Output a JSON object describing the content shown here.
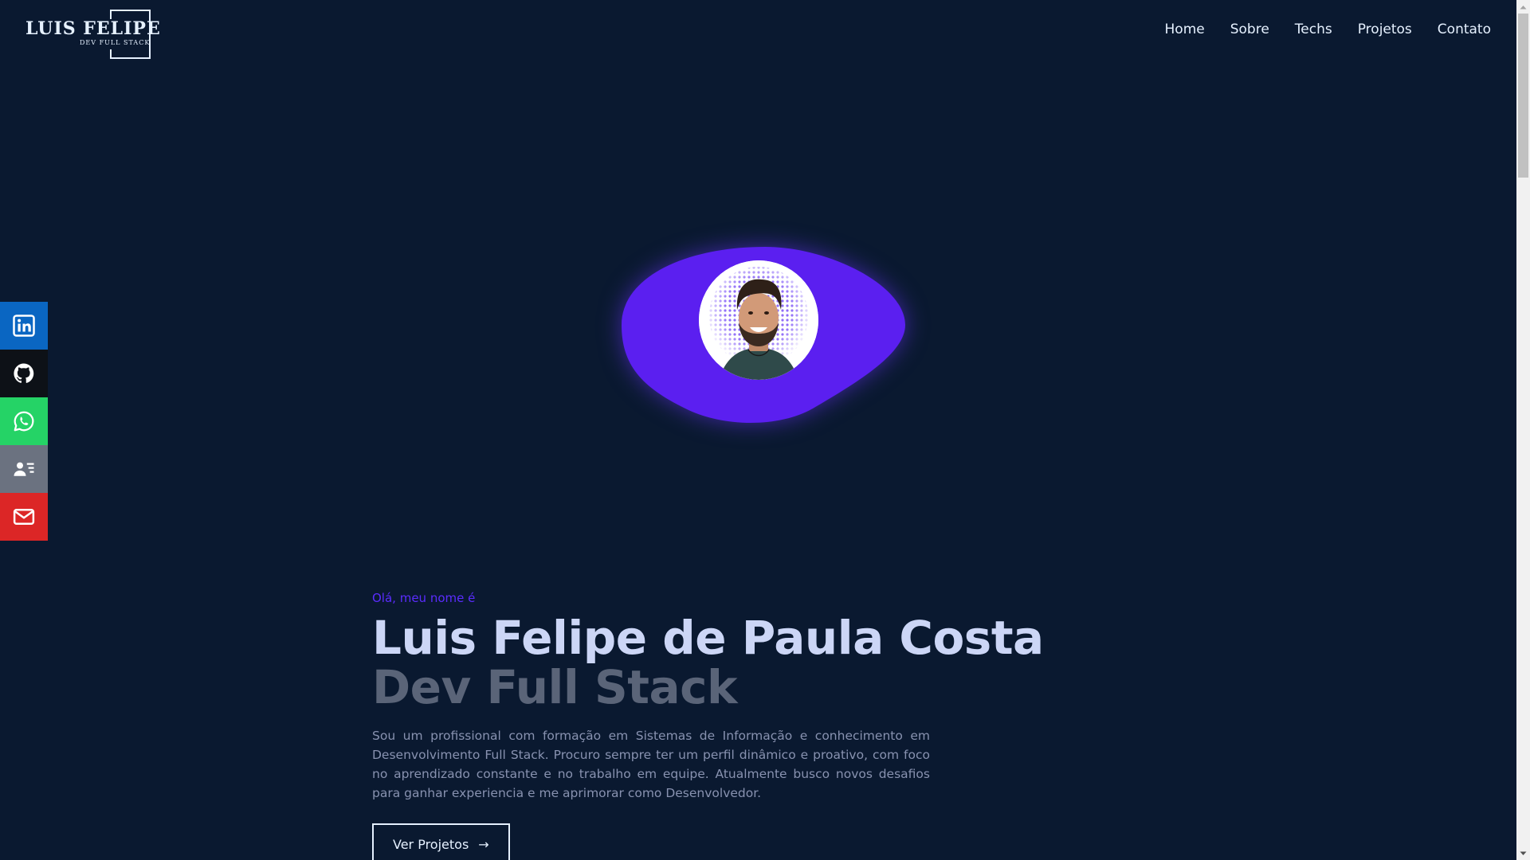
{
  "header": {
    "logo_title": "LUIS FELIPE",
    "logo_subtitle": "DEV FULL STACK",
    "nav": [
      "Home",
      "Sobre",
      "Techs",
      "Projetos",
      "Contato"
    ]
  },
  "social": [
    {
      "name": "linkedin",
      "icon": "linkedin-icon",
      "color": "#0a66c2"
    },
    {
      "name": "github",
      "icon": "github-icon",
      "color": "#0d1117"
    },
    {
      "name": "whatsapp",
      "icon": "whatsapp-icon",
      "color": "#25d366"
    },
    {
      "name": "curriculo",
      "icon": "contact-card-icon",
      "color": "#6b7280"
    },
    {
      "name": "email",
      "icon": "mail-icon",
      "color": "#dc2626"
    }
  ],
  "hero": {
    "greeting": "Olá, meu nome é",
    "name": "Luis Felipe de Paula Costa",
    "role": "Dev Full Stack",
    "bio": "Sou um profissional com formação em Sistemas de Informação e conhecimento em Desenvolvimento Full Stack. Procuro sempre ter um perfil dinâmico e proativo, com foco no aprendizado constante e no trabalho em equipe. Atualmente busco novos desafios para ganhar experiencia e me aprimorar como Desenvolvedor.",
    "cta_label": "Ver Projetos",
    "cta_arrow": "→"
  },
  "colors": {
    "background": "#0a1930",
    "accent": "#5b2cff",
    "blob": "#5b1ff0",
    "heading": "#ccd6f6",
    "muted_heading": "#5a6478",
    "body_text": "#8892b0"
  }
}
